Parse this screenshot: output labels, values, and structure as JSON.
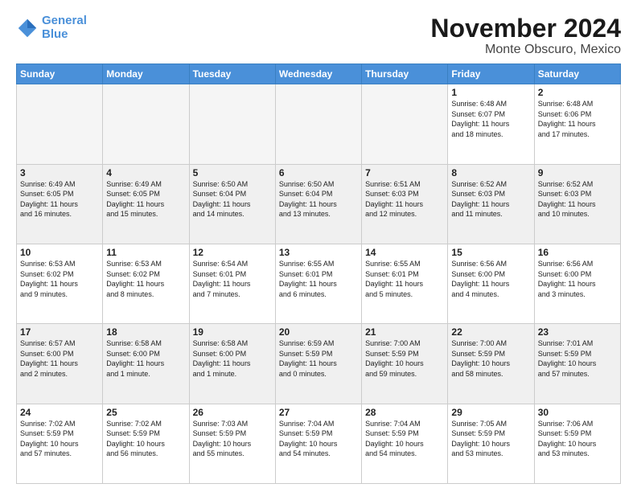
{
  "logo": {
    "line1": "General",
    "line2": "Blue"
  },
  "title": "November 2024",
  "location": "Monte Obscuro, Mexico",
  "headers": [
    "Sunday",
    "Monday",
    "Tuesday",
    "Wednesday",
    "Thursday",
    "Friday",
    "Saturday"
  ],
  "weeks": [
    [
      {
        "day": "",
        "info": "",
        "empty": true
      },
      {
        "day": "",
        "info": "",
        "empty": true
      },
      {
        "day": "",
        "info": "",
        "empty": true
      },
      {
        "day": "",
        "info": "",
        "empty": true
      },
      {
        "day": "",
        "info": "",
        "empty": true
      },
      {
        "day": "1",
        "info": "Sunrise: 6:48 AM\nSunset: 6:07 PM\nDaylight: 11 hours\nand 18 minutes.",
        "empty": false
      },
      {
        "day": "2",
        "info": "Sunrise: 6:48 AM\nSunset: 6:06 PM\nDaylight: 11 hours\nand 17 minutes.",
        "empty": false
      }
    ],
    [
      {
        "day": "3",
        "info": "Sunrise: 6:49 AM\nSunset: 6:05 PM\nDaylight: 11 hours\nand 16 minutes.",
        "empty": false
      },
      {
        "day": "4",
        "info": "Sunrise: 6:49 AM\nSunset: 6:05 PM\nDaylight: 11 hours\nand 15 minutes.",
        "empty": false
      },
      {
        "day": "5",
        "info": "Sunrise: 6:50 AM\nSunset: 6:04 PM\nDaylight: 11 hours\nand 14 minutes.",
        "empty": false
      },
      {
        "day": "6",
        "info": "Sunrise: 6:50 AM\nSunset: 6:04 PM\nDaylight: 11 hours\nand 13 minutes.",
        "empty": false
      },
      {
        "day": "7",
        "info": "Sunrise: 6:51 AM\nSunset: 6:03 PM\nDaylight: 11 hours\nand 12 minutes.",
        "empty": false
      },
      {
        "day": "8",
        "info": "Sunrise: 6:52 AM\nSunset: 6:03 PM\nDaylight: 11 hours\nand 11 minutes.",
        "empty": false
      },
      {
        "day": "9",
        "info": "Sunrise: 6:52 AM\nSunset: 6:03 PM\nDaylight: 11 hours\nand 10 minutes.",
        "empty": false
      }
    ],
    [
      {
        "day": "10",
        "info": "Sunrise: 6:53 AM\nSunset: 6:02 PM\nDaylight: 11 hours\nand 9 minutes.",
        "empty": false
      },
      {
        "day": "11",
        "info": "Sunrise: 6:53 AM\nSunset: 6:02 PM\nDaylight: 11 hours\nand 8 minutes.",
        "empty": false
      },
      {
        "day": "12",
        "info": "Sunrise: 6:54 AM\nSunset: 6:01 PM\nDaylight: 11 hours\nand 7 minutes.",
        "empty": false
      },
      {
        "day": "13",
        "info": "Sunrise: 6:55 AM\nSunset: 6:01 PM\nDaylight: 11 hours\nand 6 minutes.",
        "empty": false
      },
      {
        "day": "14",
        "info": "Sunrise: 6:55 AM\nSunset: 6:01 PM\nDaylight: 11 hours\nand 5 minutes.",
        "empty": false
      },
      {
        "day": "15",
        "info": "Sunrise: 6:56 AM\nSunset: 6:00 PM\nDaylight: 11 hours\nand 4 minutes.",
        "empty": false
      },
      {
        "day": "16",
        "info": "Sunrise: 6:56 AM\nSunset: 6:00 PM\nDaylight: 11 hours\nand 3 minutes.",
        "empty": false
      }
    ],
    [
      {
        "day": "17",
        "info": "Sunrise: 6:57 AM\nSunset: 6:00 PM\nDaylight: 11 hours\nand 2 minutes.",
        "empty": false
      },
      {
        "day": "18",
        "info": "Sunrise: 6:58 AM\nSunset: 6:00 PM\nDaylight: 11 hours\nand 1 minute.",
        "empty": false
      },
      {
        "day": "19",
        "info": "Sunrise: 6:58 AM\nSunset: 6:00 PM\nDaylight: 11 hours\nand 1 minute.",
        "empty": false
      },
      {
        "day": "20",
        "info": "Sunrise: 6:59 AM\nSunset: 5:59 PM\nDaylight: 11 hours\nand 0 minutes.",
        "empty": false
      },
      {
        "day": "21",
        "info": "Sunrise: 7:00 AM\nSunset: 5:59 PM\nDaylight: 10 hours\nand 59 minutes.",
        "empty": false
      },
      {
        "day": "22",
        "info": "Sunrise: 7:00 AM\nSunset: 5:59 PM\nDaylight: 10 hours\nand 58 minutes.",
        "empty": false
      },
      {
        "day": "23",
        "info": "Sunrise: 7:01 AM\nSunset: 5:59 PM\nDaylight: 10 hours\nand 57 minutes.",
        "empty": false
      }
    ],
    [
      {
        "day": "24",
        "info": "Sunrise: 7:02 AM\nSunset: 5:59 PM\nDaylight: 10 hours\nand 57 minutes.",
        "empty": false
      },
      {
        "day": "25",
        "info": "Sunrise: 7:02 AM\nSunset: 5:59 PM\nDaylight: 10 hours\nand 56 minutes.",
        "empty": false
      },
      {
        "day": "26",
        "info": "Sunrise: 7:03 AM\nSunset: 5:59 PM\nDaylight: 10 hours\nand 55 minutes.",
        "empty": false
      },
      {
        "day": "27",
        "info": "Sunrise: 7:04 AM\nSunset: 5:59 PM\nDaylight: 10 hours\nand 54 minutes.",
        "empty": false
      },
      {
        "day": "28",
        "info": "Sunrise: 7:04 AM\nSunset: 5:59 PM\nDaylight: 10 hours\nand 54 minutes.",
        "empty": false
      },
      {
        "day": "29",
        "info": "Sunrise: 7:05 AM\nSunset: 5:59 PM\nDaylight: 10 hours\nand 53 minutes.",
        "empty": false
      },
      {
        "day": "30",
        "info": "Sunrise: 7:06 AM\nSunset: 5:59 PM\nDaylight: 10 hours\nand 53 minutes.",
        "empty": false
      }
    ]
  ]
}
